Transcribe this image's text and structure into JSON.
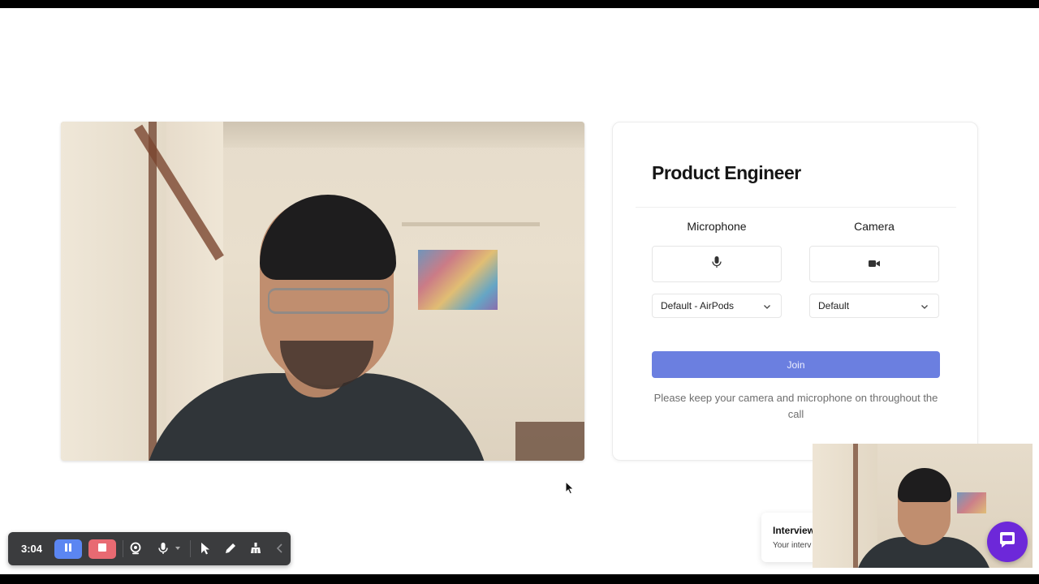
{
  "join_card": {
    "title": "Product Engineer",
    "microphone": {
      "label": "Microphone",
      "selected": "Default - AirPods"
    },
    "camera": {
      "label": "Camera",
      "selected": "Default"
    },
    "join_label": "Join",
    "help_text": "Please keep your camera and microphone on throughout the call"
  },
  "toast": {
    "title": "Interview",
    "subtitle": "Your interv"
  },
  "recorder": {
    "timer": "3:04"
  },
  "colors": {
    "join_button": "#6b7fe0",
    "pause_button": "#5b86f2",
    "stop_button": "#e86a72",
    "chat_button": "#6d28d9",
    "toolbar_bg": "#3b3c3e"
  },
  "icons": [
    "microphone-icon",
    "video-camera-icon",
    "chevron-down-icon",
    "pause-icon",
    "stop-icon",
    "webcam-icon",
    "mic-icon",
    "pointer-icon",
    "pen-icon",
    "eraser-icon",
    "collapse-icon",
    "chat-icon"
  ]
}
